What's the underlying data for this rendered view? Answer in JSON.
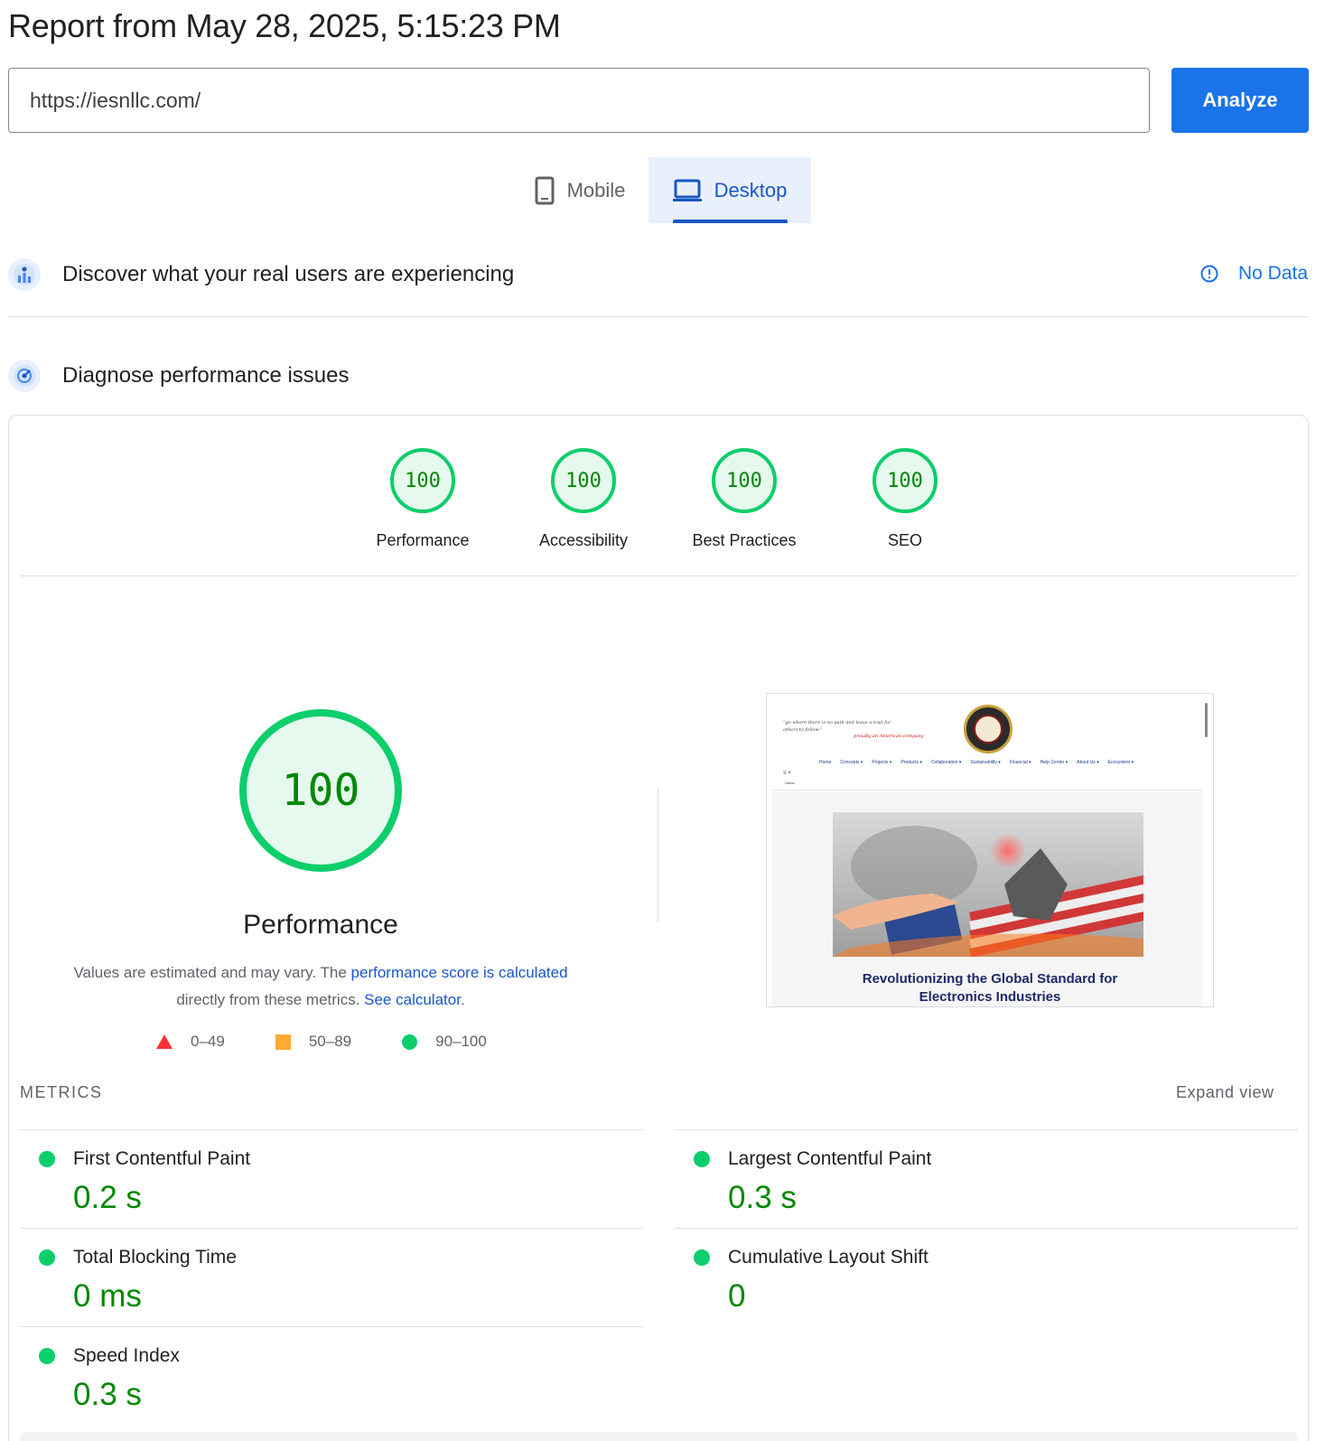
{
  "report": {
    "title": "Report from May 28, 2025, 5:15:23 PM"
  },
  "search": {
    "url": "https://iesnllc.com/",
    "analyze_label": "Analyze"
  },
  "device_tabs": [
    {
      "label": "Mobile",
      "icon": "phone-icon",
      "selected": false
    },
    {
      "label": "Desktop",
      "icon": "laptop-icon",
      "selected": true
    }
  ],
  "real_users": {
    "title": "Discover what your real users are experiencing",
    "status": "No Data"
  },
  "diagnose": {
    "title": "Diagnose performance issues"
  },
  "categories": [
    {
      "label": "Performance",
      "score": "100"
    },
    {
      "label": "Accessibility",
      "score": "100"
    },
    {
      "label": "Best Practices",
      "score": "100"
    },
    {
      "label": "SEO",
      "score": "100"
    }
  ],
  "performance": {
    "score": "100",
    "label": "Performance",
    "note_prefix": "Values are estimated and may vary. The ",
    "note_link1": "performance score is calculated",
    "note_middle": " directly from these metrics. ",
    "note_link2": "See calculator",
    "note_suffix": "."
  },
  "legend": [
    {
      "range": "0–49",
      "color": "#ff3333",
      "shape": "triangle"
    },
    {
      "range": "50–89",
      "color": "#ffaa33",
      "shape": "square"
    },
    {
      "range": "90–100",
      "color": "#0cce6b",
      "shape": "circle"
    }
  ],
  "screenshot": {
    "caption_line1": "Revolutionizing the Global Standard for",
    "caption_line2": "Electronics Industries",
    "nav": [
      "Home",
      "Concepts ▾",
      "Projects ▾",
      "Products ▾",
      "Collaboration ▾",
      "Sustainability ▾",
      "Financial ▾",
      "Help Center ▾",
      "About Us ▾",
      "Ecosystem ▾"
    ],
    "menu": "≡ ×",
    "home": "Home"
  },
  "metrics": {
    "header": "METRICS",
    "expand": "Expand view",
    "items": [
      {
        "name": "First Contentful Paint",
        "value": "0.2 s"
      },
      {
        "name": "Largest Contentful Paint",
        "value": "0.3 s"
      },
      {
        "name": "Total Blocking Time",
        "value": "0 ms"
      },
      {
        "name": "Cumulative Layout Shift",
        "value": "0"
      },
      {
        "name": "Speed Index",
        "value": "0.3 s"
      }
    ]
  },
  "colors": {
    "accent": "#1a73e8",
    "pass": "#0cce6b",
    "pass_text": "#008800"
  }
}
